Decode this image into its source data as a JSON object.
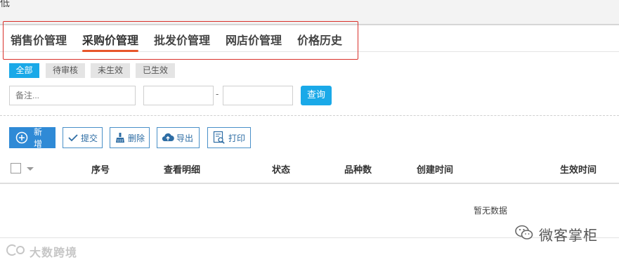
{
  "header": {
    "title": "低"
  },
  "tabs": [
    {
      "label": "销售价管理",
      "active": false
    },
    {
      "label": "采购价管理",
      "active": true
    },
    {
      "label": "批发价管理",
      "active": false
    },
    {
      "label": "网店价管理",
      "active": false
    },
    {
      "label": "价格历史",
      "active": false
    }
  ],
  "filters": [
    {
      "label": "全部",
      "active": true
    },
    {
      "label": "待审核",
      "active": false
    },
    {
      "label": "未生效",
      "active": false
    },
    {
      "label": "已生效",
      "active": false
    }
  ],
  "search": {
    "remark_placeholder": "备注...",
    "range_separator": "-",
    "query_label": "查询"
  },
  "toolbar": {
    "add_label": "新增",
    "submit_label": "提交",
    "delete_label": "删除",
    "export_label": "导出",
    "print_label": "打印"
  },
  "table": {
    "columns": [
      "序号",
      "查看明细",
      "状态",
      "品种数",
      "创建时间",
      "生效时间"
    ],
    "empty_text": "暂无数据"
  },
  "watermarks": {
    "left": "大数跨境",
    "right": "微客掌柜"
  },
  "colors": {
    "accent": "#1aa9e8",
    "primary_button": "#2f8ad6",
    "tab_underline": "#e8562a",
    "highlight_box": "#d9302a"
  },
  "icons": [
    "plus-circle-icon",
    "check-icon",
    "broom-icon",
    "cloud-upload-icon",
    "print-preview-icon",
    "chevron-down-icon",
    "wechat-icon"
  ]
}
